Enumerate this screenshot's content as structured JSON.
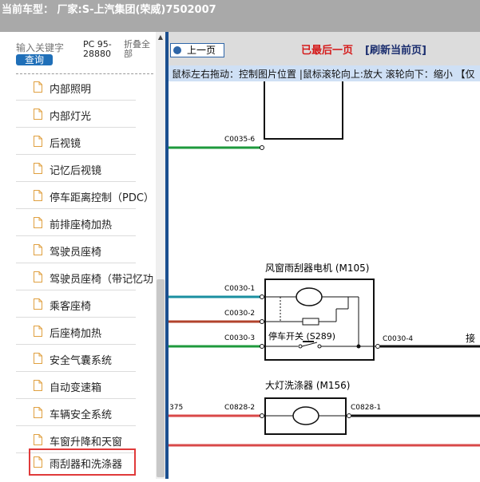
{
  "header": {
    "title": "当前车型： 厂家:S-上汽集团(荣威)7502007"
  },
  "sidebar": {
    "search_placeholder": "输入关键字",
    "query_button": "查询",
    "pc_label": "PC 95-28880",
    "fold_all": "折叠全部",
    "items": [
      {
        "label": "内部照明"
      },
      {
        "label": "内部灯光"
      },
      {
        "label": "后视镜"
      },
      {
        "label": "记忆后视镜"
      },
      {
        "label": "停车距离控制（PDC）"
      },
      {
        "label": "前排座椅加热"
      },
      {
        "label": "驾驶员座椅"
      },
      {
        "label": "驾驶员座椅（带记忆功"
      },
      {
        "label": "乘客座椅"
      },
      {
        "label": "后座椅加热"
      },
      {
        "label": "安全气囊系统"
      },
      {
        "label": "自动变速箱"
      },
      {
        "label": "车辆安全系统"
      },
      {
        "label": "车窗升降和天窗"
      },
      {
        "label": "雨刮器和洗涤器",
        "selected": true
      }
    ]
  },
  "viewer": {
    "prev_button": "上一页",
    "last_page": "已最后一页",
    "refresh": "[刷新当前页]",
    "hint": "鼠标左右拖动：控制图片位置 |鼠标滚轮向上:放大  滚轮向下：缩小 【仅"
  },
  "diagram": {
    "connectors": {
      "c0035_6": "C0035-6",
      "c0030_1": "C0030-1",
      "c0030_2": "C0030-2",
      "c0030_3": "C0030-3",
      "c0030_4": "C0030-4",
      "c0828_2": "C0828-2",
      "c0828_1": "C0828-1",
      "edge_left": "375"
    },
    "wiper_motor": "风窗雨刮器电机 (M105)",
    "park_switch": "停车开关 (S289)",
    "washer": "大灯洗涤器 (M156)",
    "right_edge": "接"
  },
  "colors": {
    "selected_border": "#e03a3a",
    "query_button": "#1f6fb8",
    "last_page": "#d51a1a"
  }
}
